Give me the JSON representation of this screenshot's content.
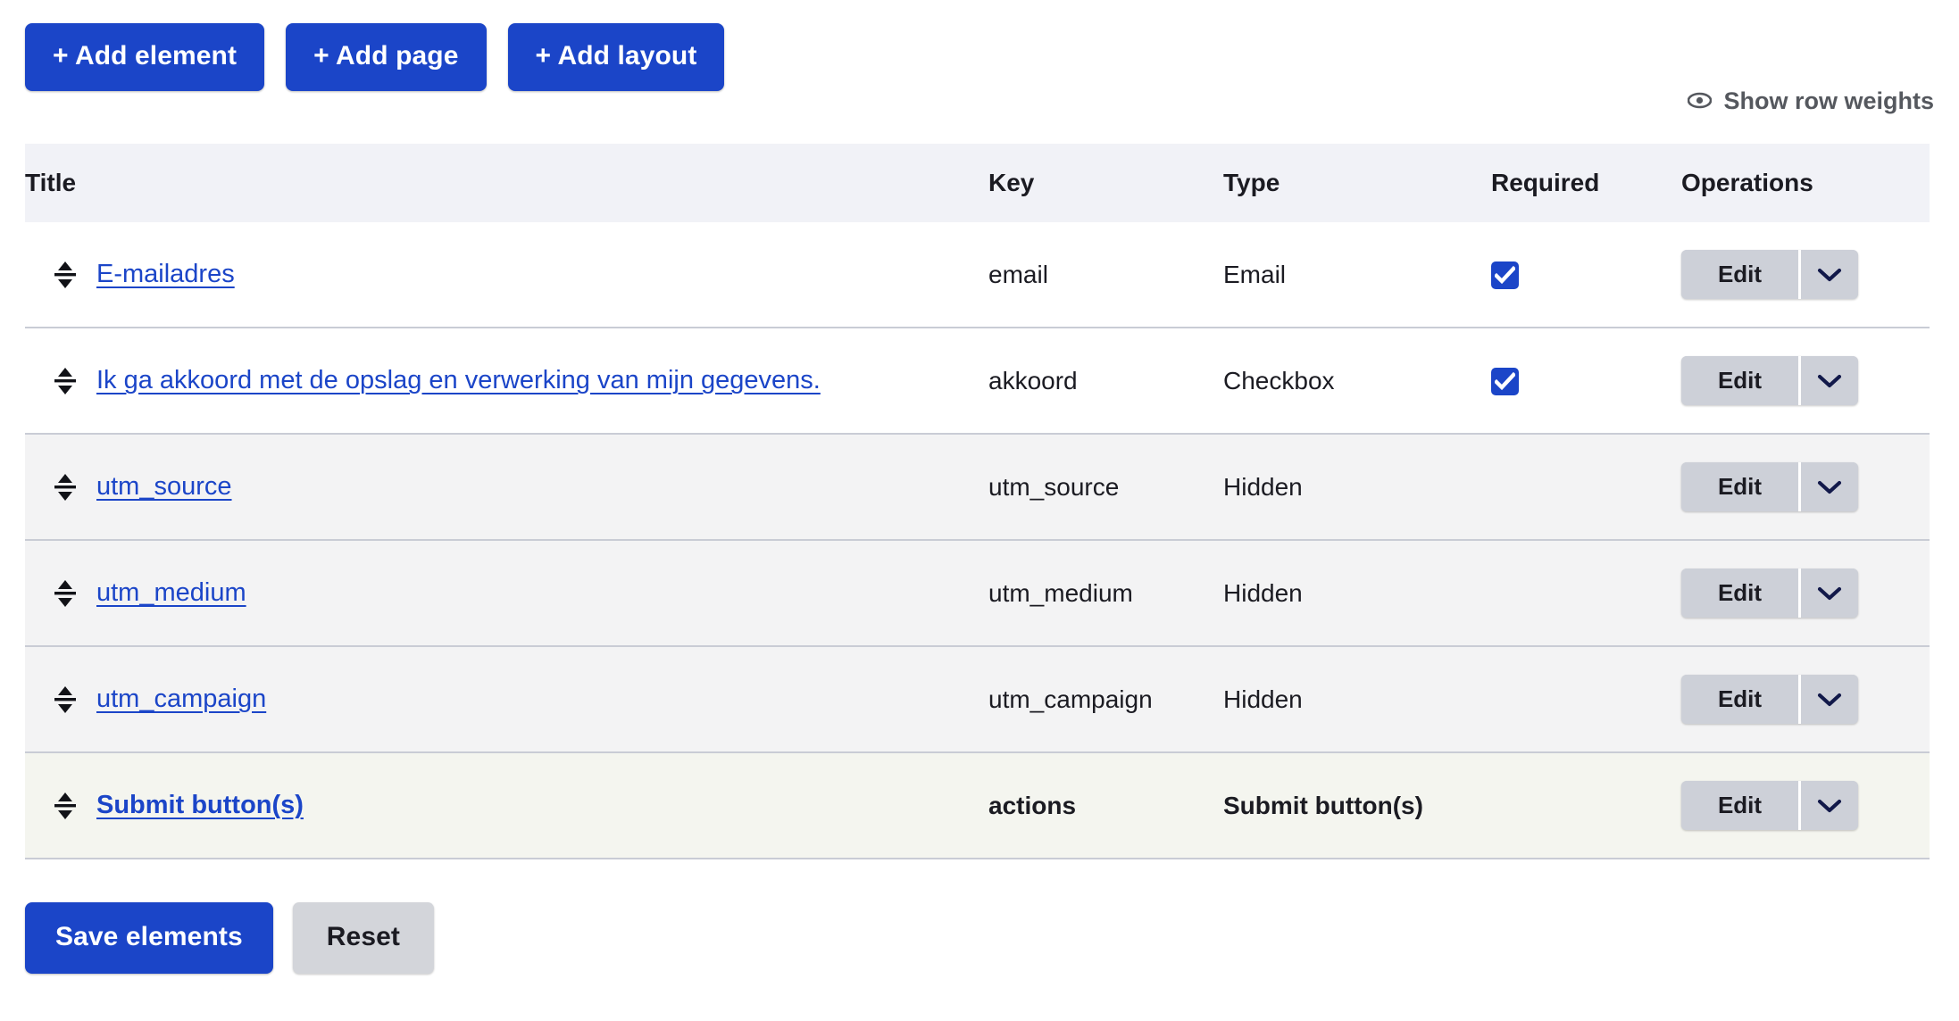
{
  "toolbar": {
    "add_element_label": "+ Add element",
    "add_page_label": "+ Add page",
    "add_layout_label": "+ Add layout"
  },
  "row_weights": {
    "label": "Show row weights",
    "icon": "eye-icon"
  },
  "table": {
    "columns": [
      "Title",
      "Key",
      "Type",
      "Required",
      "Operations"
    ],
    "rows": [
      {
        "title": "E-mailadres",
        "key": "email",
        "type": "Email",
        "required": true,
        "operation_label": "Edit",
        "style": "white",
        "bold": false,
        "muted": false
      },
      {
        "title": "Ik ga akkoord met de opslag en verwerking van mijn gegevens.",
        "key": "akkoord",
        "type": "Checkbox",
        "required": true,
        "operation_label": "Edit",
        "style": "white",
        "bold": false,
        "muted": false
      },
      {
        "title": "utm_source",
        "key": "utm_source",
        "type": "Hidden",
        "required": false,
        "operation_label": "Edit",
        "style": "grey",
        "bold": false,
        "muted": true
      },
      {
        "title": "utm_medium",
        "key": "utm_medium",
        "type": "Hidden",
        "required": false,
        "operation_label": "Edit",
        "style": "grey",
        "bold": false,
        "muted": true
      },
      {
        "title": "utm_campaign",
        "key": "utm_campaign",
        "type": "Hidden",
        "required": false,
        "operation_label": "Edit",
        "style": "grey",
        "bold": false,
        "muted": true
      },
      {
        "title": "Submit button(s)",
        "key": "actions",
        "type": "Submit button(s)",
        "required": false,
        "operation_label": "Edit",
        "style": "olive",
        "bold": true,
        "muted": false
      }
    ]
  },
  "form_actions": {
    "save_label": "Save elements",
    "reset_label": "Reset"
  },
  "colors": {
    "primary": "#1b45c8",
    "header_bg": "#f1f2f7",
    "row_grey": "#f3f3f4",
    "row_olive": "#f4f5ef",
    "button_grey": "#cdd0d8",
    "muted_text": "#5c5f66",
    "link": "#1b45c8"
  }
}
